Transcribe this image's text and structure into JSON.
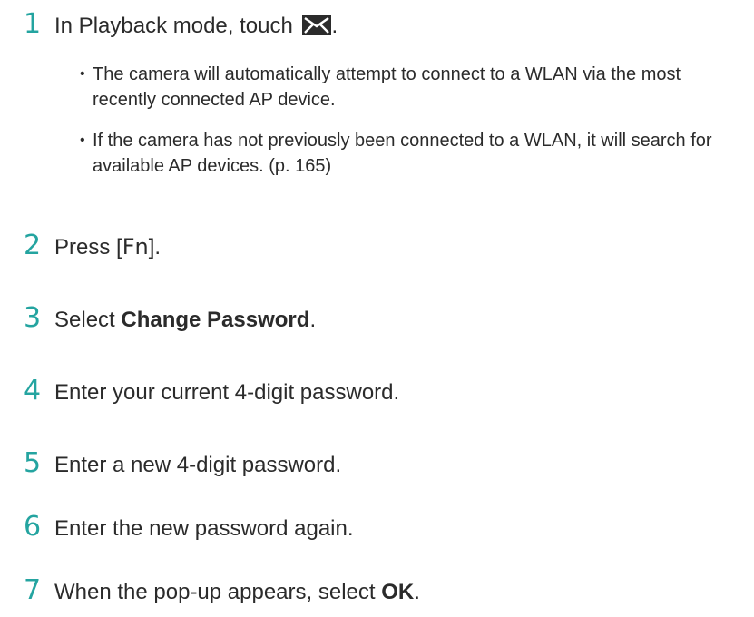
{
  "steps": [
    {
      "num": "1",
      "text": "In Playback mode, touch ",
      "icon": "wlan-mail-icon",
      "suffix": "."
    },
    {
      "num": "2",
      "prefix": "Press [",
      "key": "Fn",
      "suffix": "]."
    },
    {
      "num": "3",
      "prefix": "Select ",
      "bold": "Change Password",
      "suffix": "."
    },
    {
      "num": "4",
      "text": "Enter your current 4-digit password."
    },
    {
      "num": "5",
      "text": "Enter a new 4-digit password."
    },
    {
      "num": "6",
      "text": "Enter the new password again."
    },
    {
      "num": "7",
      "prefix": "When the pop-up appears, select ",
      "bold": "OK",
      "suffix": "."
    }
  ],
  "bullets": [
    "The camera will automatically attempt to connect to a WLAN via the most recently connected AP device.",
    "If the camera has not previously been connected to a WLAN, it will search for available AP devices. (p. 165)"
  ],
  "bullet_mark": "•",
  "colors": {
    "step_number": "#24a4a0",
    "text": "#2b2b2b",
    "icon_bg": "#2b2b2b"
  }
}
